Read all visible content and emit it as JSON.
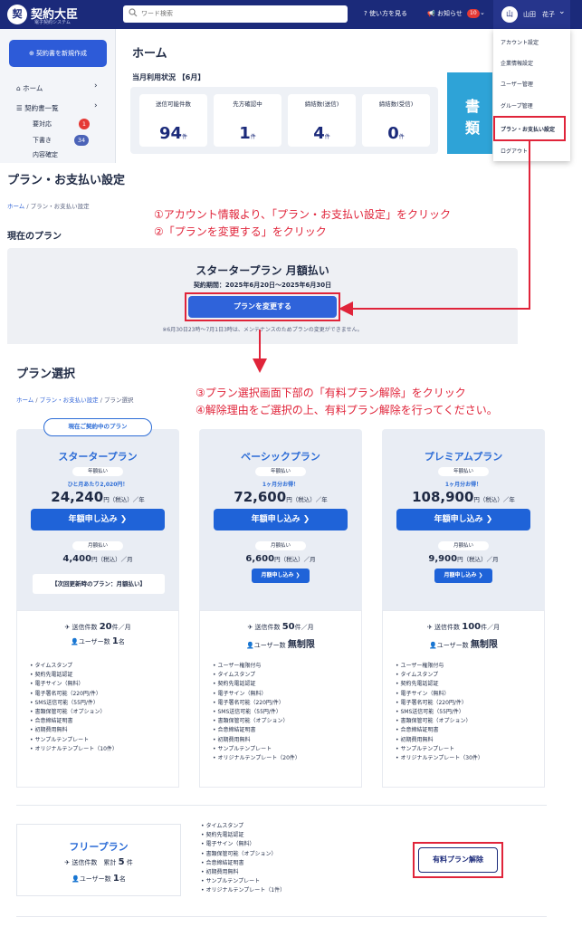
{
  "header": {
    "logo_mark": "契",
    "logo_text": "契約大臣",
    "logo_sub": "電子契約システム",
    "search_placeholder": "ワード検索",
    "help_label": "使い方を見る",
    "notif_label": "お知らせ",
    "notif_count": "10",
    "user_initial": "山",
    "user_name": "山田　花子"
  },
  "dropdown": {
    "items": [
      "アカウント設定",
      "企業情報設定",
      "ユーザー管理",
      "グループ管理",
      "プラン・お支払い設定",
      "ログアウト"
    ]
  },
  "sidebar": {
    "new_contract": "契約書を新規作成",
    "home": "ホーム",
    "contracts": "契約書一覧",
    "pending": "要対応",
    "pending_count": "1",
    "drafts": "下書き",
    "drafts_count": "34",
    "review": "内容確定"
  },
  "home": {
    "title": "ホーム",
    "usage_title": "当月利用状況 【6月】",
    "stats": [
      {
        "label": "送信可能件数",
        "value": "94",
        "unit": "件"
      },
      {
        "label": "先方確認中",
        "value": "1",
        "unit": "件"
      },
      {
        "label": "締結数(送信)",
        "value": "4",
        "unit": "件"
      },
      {
        "label": "締結数(受信)",
        "value": "0",
        "unit": "件"
      }
    ],
    "banner_text": "書類"
  },
  "page": {
    "title": "プラン・お支払い設定",
    "crumb_home": "ホーム",
    "crumb_sep": "/",
    "crumb_current": "プラン・お支払い設定",
    "current_label": "現在のプラン"
  },
  "annotations": {
    "step1": "①アカウント情報より、「プラン・お支払い設定」をクリック",
    "step2": "②「プランを変更する」をクリック",
    "step3": "③プラン選択画面下部の「有料プラン解除」をクリック",
    "step4": "④解除理由をご選択の上、有料プラン解除を行ってください。"
  },
  "current_plan": {
    "name": "スタータープラン 月額払い",
    "period": "契約期間：2025年6月20日〜2025年6月30日",
    "change_button": "プランを変更する",
    "note": "※6月30日23時〜7月1日3時は、メンテナンスのためプランの変更ができません。"
  },
  "plan_select": {
    "title": "プラン選択",
    "crumb_home": "ホーム",
    "crumb_mid": "プラン・お支払い設定",
    "crumb_current": "プラン選択",
    "current_tag": "現在ご契約中のプラン"
  },
  "plans": [
    {
      "name": "スタータープラン",
      "year_chip": "年額払い",
      "promo": "ひと月あたり2,020円！",
      "year_price": "24,240",
      "year_suffix": "円（税込）／年",
      "year_button": "年額申し込み ❯",
      "month_chip": "月額払い",
      "month_price": "4,400",
      "month_suffix": "円（税込）／月",
      "next_plan": "【次回更新時のプラン：月額払い】",
      "send_label": "送信件数",
      "send_value": "20",
      "send_unit": "件／月",
      "users_label": "ユーザー数",
      "users_value": "1",
      "users_unit": "名",
      "features": [
        "タイムスタンプ",
        "契約先電話認証",
        "電子サイン（無料）",
        "電子署名可能（220円/件）",
        "SMS送信可能（55円/件）",
        "書類保管可能（オプション）",
        "合意締結証明書",
        "初期費用無料",
        "サンプルテンプレート",
        "オリジナルテンプレート（10件）"
      ]
    },
    {
      "name": "ベーシックプラン",
      "year_chip": "年額払い",
      "promo": "1ヶ月分お得！",
      "year_price": "72,600",
      "year_suffix": "円（税込）／年",
      "year_button": "年額申し込み ❯",
      "month_chip": "月額払い",
      "month_price": "6,600",
      "month_suffix": "円（税込）／月",
      "month_button": "月額申し込み ❯",
      "send_label": "送信件数",
      "send_value": "50",
      "send_unit": "件／月",
      "users_label": "ユーザー数",
      "users_value": "無制限",
      "users_unit": "",
      "features": [
        "ユーザー権限付与",
        "タイムスタンプ",
        "契約先電話認証",
        "電子サイン（無料）",
        "電子署名可能（220円/件）",
        "SMS送信可能（55円/件）",
        "書類保管可能（オプション）",
        "合意締結証明書",
        "初期費用無料",
        "サンプルテンプレート",
        "オリジナルテンプレート（20件）"
      ]
    },
    {
      "name": "プレミアムプラン",
      "year_chip": "年額払い",
      "promo": "1ヶ月分お得！",
      "year_price": "108,900",
      "year_suffix": "円（税込）／年",
      "year_button": "年額申し込み ❯",
      "month_chip": "月額払い",
      "month_price": "9,900",
      "month_suffix": "円（税込）／月",
      "month_button": "月額申し込み ❯",
      "send_label": "送信件数",
      "send_value": "100",
      "send_unit": "件／月",
      "users_label": "ユーザー数",
      "users_value": "無制限",
      "users_unit": "",
      "features": [
        "ユーザー権限付与",
        "タイムスタンプ",
        "契約先電話認証",
        "電子サイン（無料）",
        "電子署名可能（220円/件）",
        "SMS送信可能（55円/件）",
        "書類保管可能（オプション）",
        "合意締結証明書",
        "初期費用無料",
        "サンプルテンプレート",
        "オリジナルテンプレート（30件）"
      ]
    }
  ],
  "free_plan": {
    "name": "フリープラン",
    "send_label": "送信件数　累計",
    "send_value": "5",
    "send_unit": "件",
    "users_label": "ユーザー数",
    "users_value": "1",
    "users_unit": "名",
    "features": [
      "タイムスタンプ",
      "契約先電話認証",
      "電子サイン（無料）",
      "書類保管可能（オプション）",
      "合意締結証明書",
      "初期費用無料",
      "サンプルテンプレート",
      "オリジナルテンプレート（1件）"
    ],
    "cancel_button": "有料プラン解除"
  },
  "colors": {
    "header": "#1b2a7a",
    "accent": "#1f63d8",
    "annotation": "#e0243a"
  }
}
